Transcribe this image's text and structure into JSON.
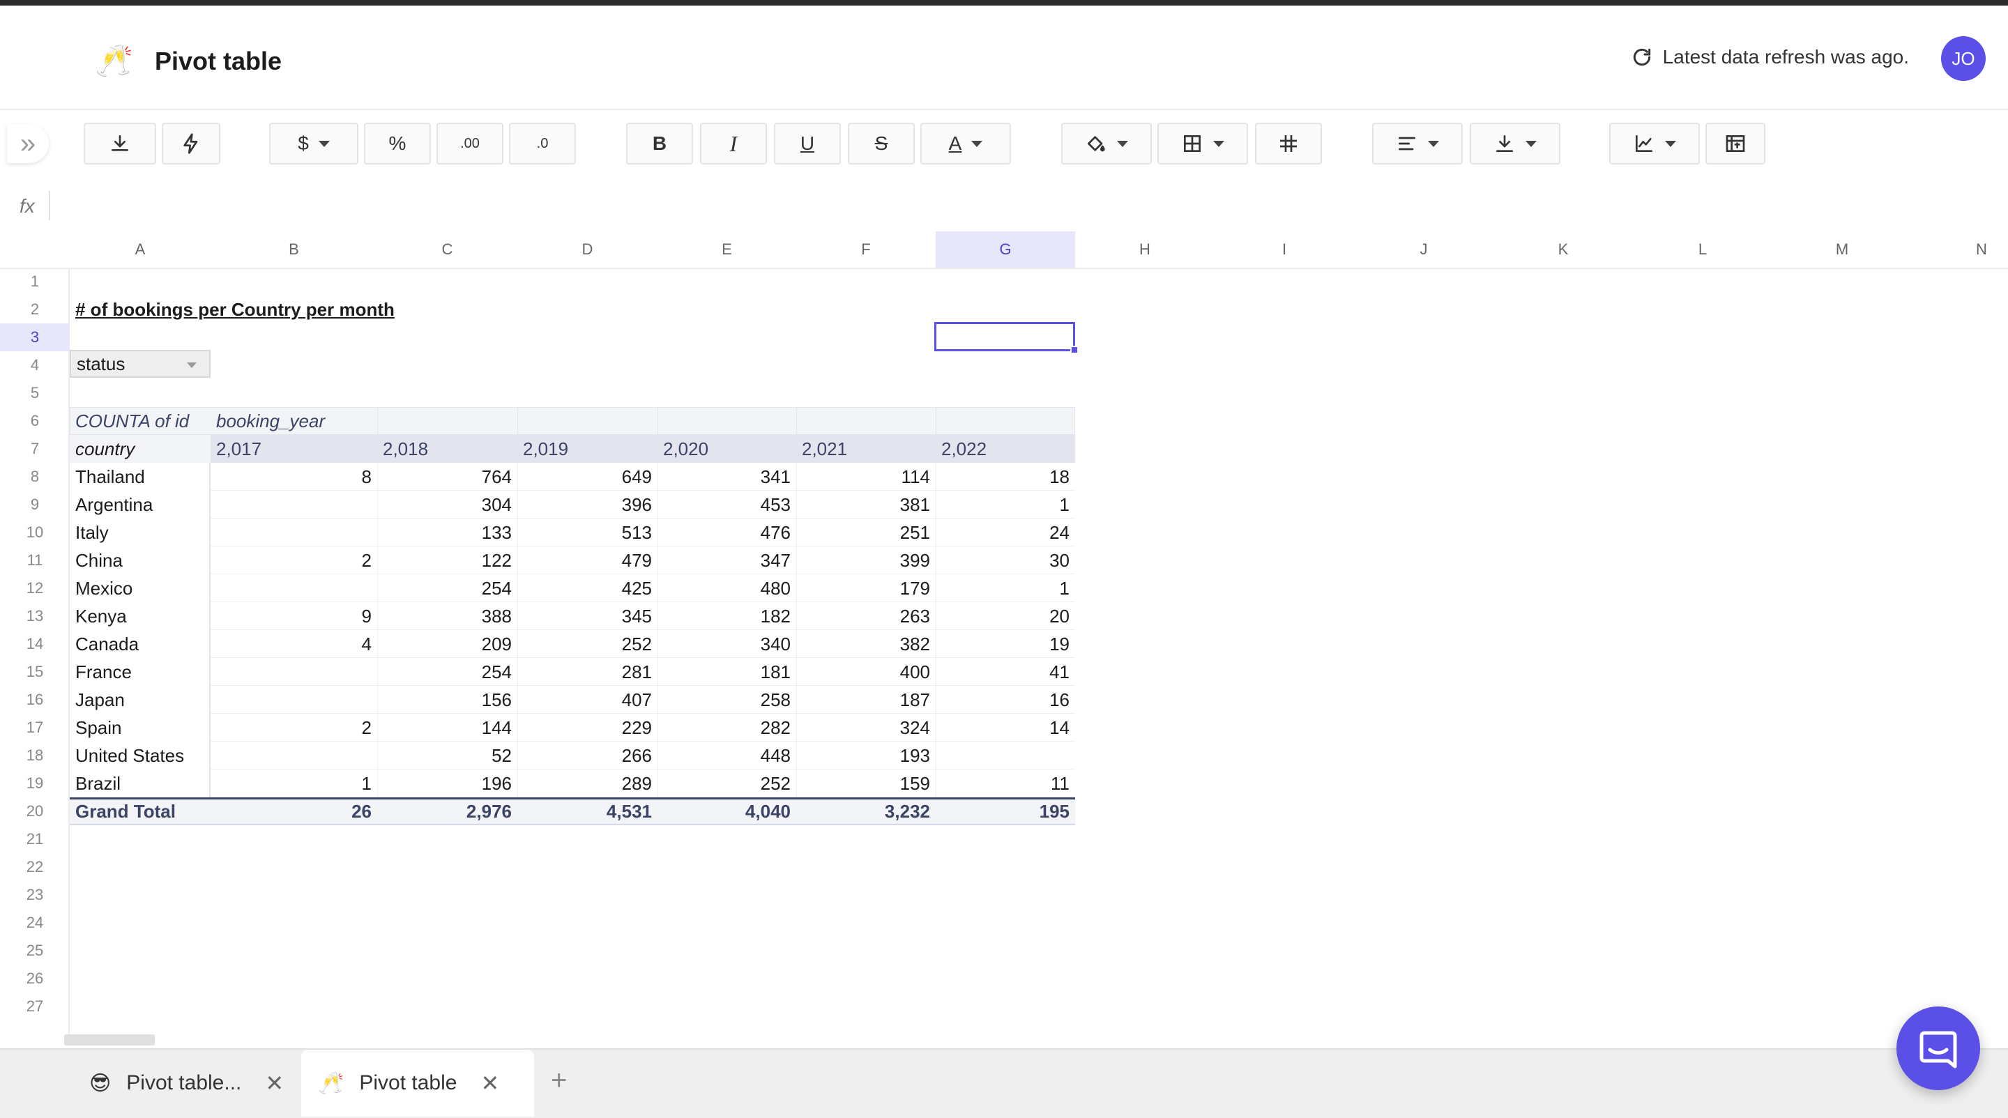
{
  "header": {
    "doc_emoji": "🥂",
    "title": "Pivot table",
    "refresh_text": "Latest data refresh was ago.",
    "avatar_initials": "JO"
  },
  "toolbar": {
    "currency_label": "$",
    "percent_label": "%",
    "increase_decimals_label": ".00",
    "decrease_decimals_label": ".0",
    "bold_label": "B",
    "italic_label": "I",
    "underline_label": "U",
    "strike_label": "S",
    "text_color_label": "A"
  },
  "formula_bar": {
    "label": "fx",
    "value": ""
  },
  "grid": {
    "columns": [
      "A",
      "B",
      "C",
      "D",
      "E",
      "F",
      "G",
      "H",
      "I",
      "J",
      "K",
      "L",
      "M",
      "N"
    ],
    "selected_column": "G",
    "rows": [
      "1",
      "2",
      "3",
      "4",
      "5",
      "6",
      "7",
      "8",
      "9",
      "10",
      "11",
      "12",
      "13",
      "14",
      "15",
      "16",
      "17",
      "18",
      "19",
      "20",
      "21",
      "22",
      "23",
      "24",
      "25",
      "26",
      "27"
    ],
    "selected_row": "3",
    "selected_cell": "G3",
    "sheet_title": "# of bookings per Country per month",
    "filter_label": "status"
  },
  "pivot": {
    "value_label": "COUNTA of id",
    "column_field": "booking_year",
    "row_field": "country",
    "years": [
      "2,017",
      "2,018",
      "2,019",
      "2,020",
      "2,021",
      "2,022"
    ],
    "rows": [
      {
        "country": "Thailand",
        "values": [
          "8",
          "764",
          "649",
          "341",
          "114",
          "18"
        ]
      },
      {
        "country": "Argentina",
        "values": [
          "",
          "304",
          "396",
          "453",
          "381",
          "1"
        ]
      },
      {
        "country": "Italy",
        "values": [
          "",
          "133",
          "513",
          "476",
          "251",
          "24"
        ]
      },
      {
        "country": "China",
        "values": [
          "2",
          "122",
          "479",
          "347",
          "399",
          "30"
        ]
      },
      {
        "country": "Mexico",
        "values": [
          "",
          "254",
          "425",
          "480",
          "179",
          "1"
        ]
      },
      {
        "country": "Kenya",
        "values": [
          "9",
          "388",
          "345",
          "182",
          "263",
          "20"
        ]
      },
      {
        "country": "Canada",
        "values": [
          "4",
          "209",
          "252",
          "340",
          "382",
          "19"
        ]
      },
      {
        "country": "France",
        "values": [
          "",
          "254",
          "281",
          "181",
          "400",
          "41"
        ]
      },
      {
        "country": "Japan",
        "values": [
          "",
          "156",
          "407",
          "258",
          "187",
          "16"
        ]
      },
      {
        "country": "Spain",
        "values": [
          "2",
          "144",
          "229",
          "282",
          "324",
          "14"
        ]
      },
      {
        "country": "United States",
        "values": [
          "",
          "52",
          "266",
          "448",
          "193",
          ""
        ]
      },
      {
        "country": "Brazil",
        "values": [
          "1",
          "196",
          "289",
          "252",
          "159",
          "11"
        ]
      }
    ],
    "total_label": "Grand Total",
    "totals": [
      "26",
      "2,976",
      "4,531",
      "4,040",
      "3,232",
      "195"
    ]
  },
  "tabs": [
    {
      "emoji": "😎",
      "label": "Pivot table...",
      "active": false
    },
    {
      "emoji": "🥂",
      "label": "Pivot table",
      "active": true
    }
  ],
  "add_tab_label": "+",
  "colors": {
    "accent": "#5a4fe6",
    "header_bg": "#f3f4f8",
    "selection_bg": "#e8e6fb"
  }
}
